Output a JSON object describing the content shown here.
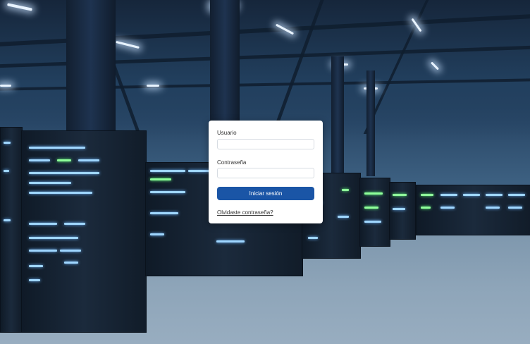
{
  "login": {
    "username_label": "Usuario",
    "username_value": "",
    "password_label": "Contraseña",
    "password_value": "",
    "submit_label": "Iniciar sesión",
    "forgot_link": "Olvidaste contraseña?"
  },
  "colors": {
    "primary_button": "#1a55a6",
    "card_background": "#ffffff",
    "background_theme": "#2a4868"
  }
}
